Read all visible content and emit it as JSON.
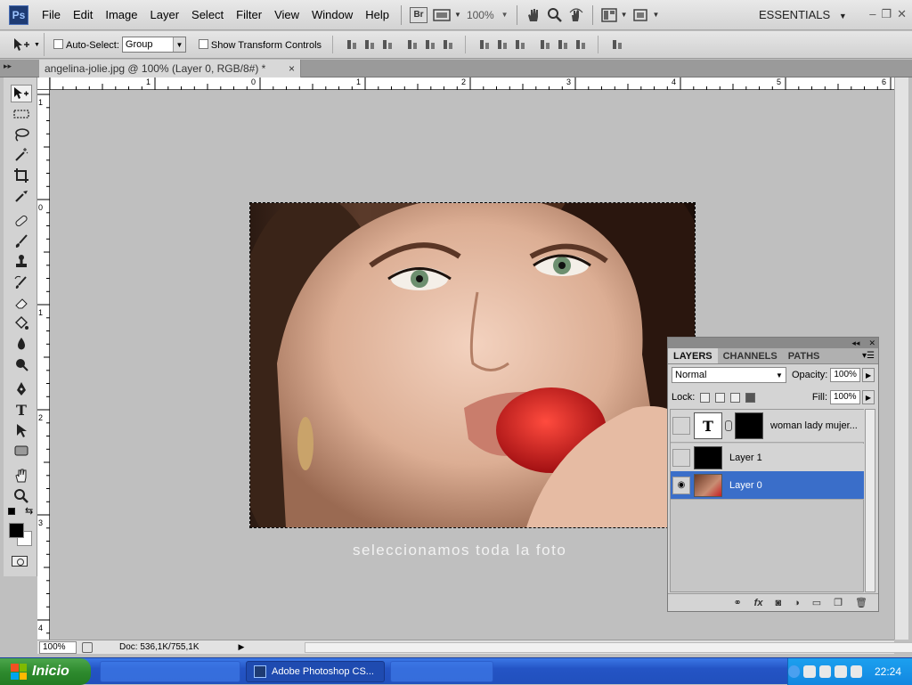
{
  "menubar": {
    "logo": "Ps",
    "items": [
      "File",
      "Edit",
      "Image",
      "Layer",
      "Select",
      "Filter",
      "View",
      "Window",
      "Help"
    ],
    "bridge": "Br",
    "zoom": "100%",
    "workspace": "ESSENTIALS"
  },
  "options": {
    "auto_select_label": "Auto-Select:",
    "auto_select_value": "Group",
    "show_transform_label": "Show Transform Controls"
  },
  "document": {
    "tab_title": "angelina-jolie.jpg @ 100% (Layer 0, RGB/8#) *",
    "close": "×",
    "caption": "seleccionamos toda la foto"
  },
  "ruler": {
    "h_labels": [
      "1",
      "0",
      "1",
      "2",
      "3",
      "4",
      "5",
      "6"
    ],
    "v_labels": [
      "1",
      "0",
      "1",
      "2",
      "3",
      "4"
    ]
  },
  "status": {
    "zoom": "100%",
    "doc_info": "Doc: 536,1K/755,1K"
  },
  "layers_panel": {
    "tabs": [
      "LAYERS",
      "CHANNELS",
      "PATHS"
    ],
    "blend_mode": "Normal",
    "opacity_label": "Opacity:",
    "opacity_value": "100%",
    "lock_label": "Lock:",
    "fill_label": "Fill:",
    "fill_value": "100%",
    "layers": [
      {
        "name": "woman lady mujer...",
        "type": "text",
        "thumb_glyph": "T",
        "visible": false,
        "selected": false
      },
      {
        "name": "Layer 1",
        "type": "fill",
        "visible": false,
        "selected": false
      },
      {
        "name": "Layer 0",
        "type": "photo",
        "visible": true,
        "selected": true
      }
    ],
    "bottom_icons": [
      "link-icon",
      "fx-icon",
      "mask-icon",
      "adjustment-icon",
      "group-icon",
      "new-layer-icon",
      "trash-icon"
    ],
    "fx_label": "fx"
  },
  "taskbar": {
    "start_label": "Inicio",
    "active_task": "Adobe Photoshop CS...",
    "clock": "22:24"
  },
  "colors": {
    "selection_blue": "#3a6ec9",
    "taskbar_blue": "#2454c5",
    "start_green": "#2e8b2e"
  }
}
